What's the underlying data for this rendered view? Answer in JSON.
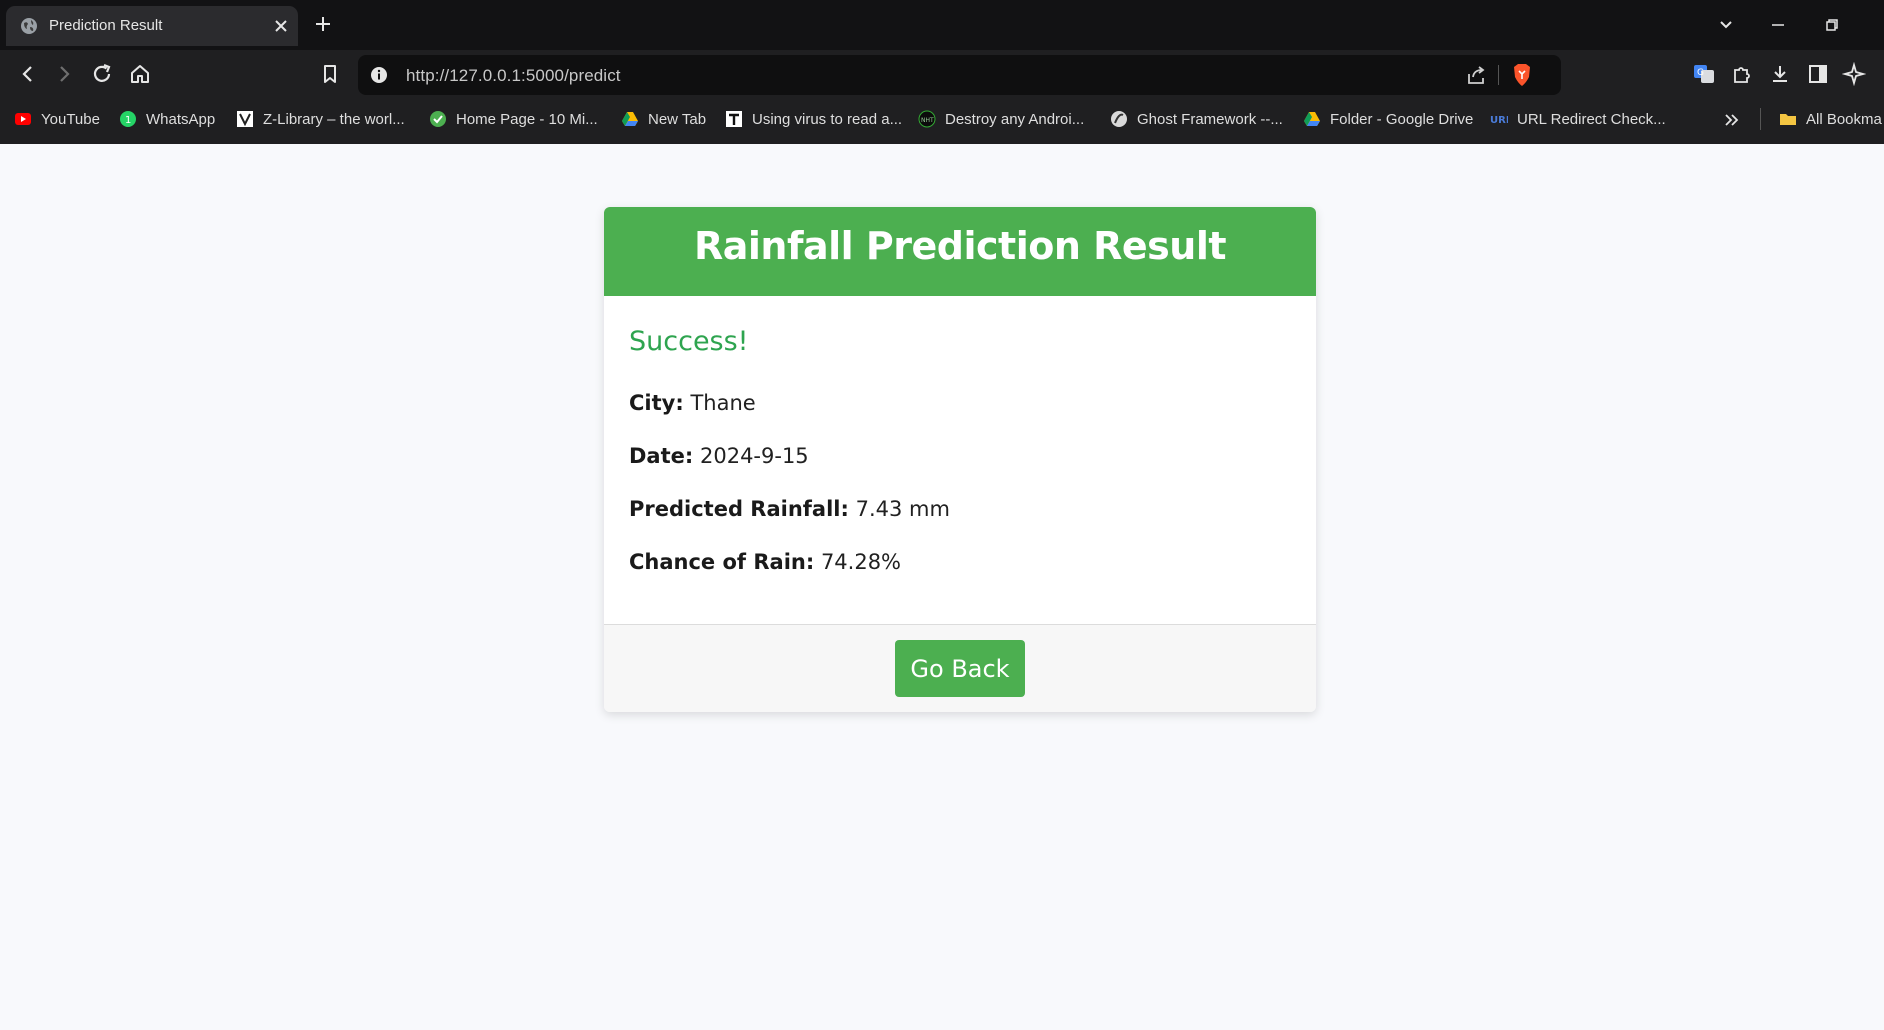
{
  "browser": {
    "tab_title": "Prediction Result",
    "url": "http://127.0.0.1:5000/predict",
    "bookmarks": [
      {
        "label": "YouTube",
        "icon": "youtube-icon"
      },
      {
        "label": "WhatsApp",
        "icon": "whatsapp-icon"
      },
      {
        "label": "Z-Library – the worl...",
        "icon": "zlibrary-icon"
      },
      {
        "label": "Home Page - 10 Mi...",
        "icon": "checkmark-icon"
      },
      {
        "label": "New Tab",
        "icon": "google-drive-icon"
      },
      {
        "label": "Using virus to read a...",
        "icon": "t-letter-icon"
      },
      {
        "label": "Destroy any Androi...",
        "icon": "nht-icon"
      },
      {
        "label": "Ghost Framework --...",
        "icon": "ghost-icon"
      },
      {
        "label": "Folder - Google Drive",
        "icon": "google-drive-icon"
      },
      {
        "label": "URL Redirect Check...",
        "icon": "redirect-checker-icon"
      }
    ],
    "all_bookmarks_label": "All Bookma"
  },
  "card": {
    "title": "Rainfall Prediction Result",
    "status": "Success!",
    "fields": [
      {
        "label": "City:",
        "value": "Thane"
      },
      {
        "label": "Date:",
        "value": "2024-9-15"
      },
      {
        "label": "Predicted Rainfall:",
        "value": "7.43 mm"
      },
      {
        "label": "Chance of Rain:",
        "value": "74.28%"
      }
    ],
    "button_label": "Go Back"
  },
  "colors": {
    "header_bg": "#4caf50",
    "success_text": "#2ea44f",
    "button_bg": "#4caf50",
    "page_bg": "#f8f9fc"
  }
}
